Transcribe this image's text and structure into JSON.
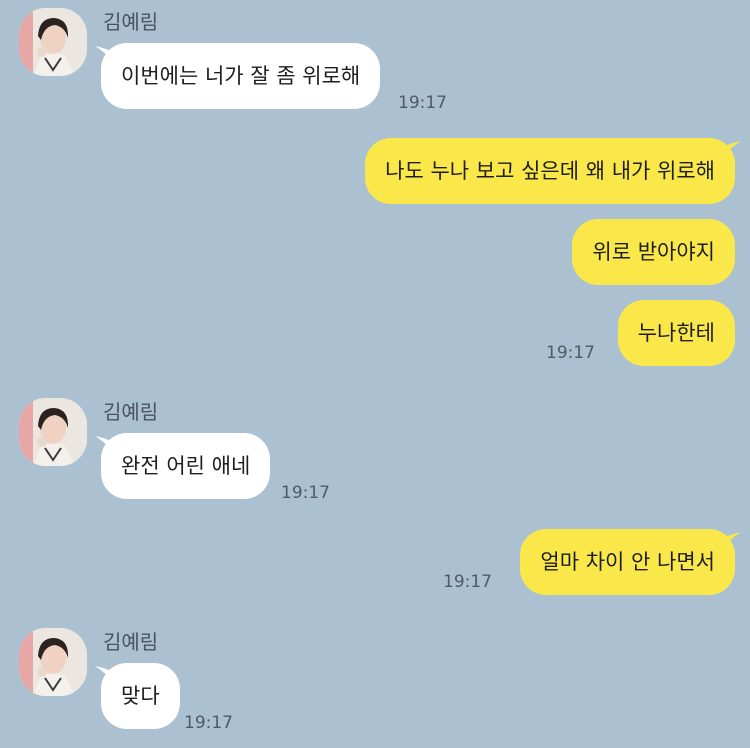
{
  "colors": {
    "background": "#abc1d1",
    "incoming_bubble": "#ffffff",
    "outgoing_bubble": "#fae84a",
    "sender_name": "#4a5260",
    "timestamp": "#4f5a66"
  },
  "messages": {
    "g1": {
      "sender": "김예림",
      "avatar_icon": "profile-photo",
      "text": "이번에는 너가 잘 좀 위로해",
      "time": "19:17"
    },
    "o1": {
      "line1": "나도 누나 보고 싶은데 왜 내가 위로해",
      "line2": "위로 받아야지",
      "line3": "누나한테",
      "time": "19:17"
    },
    "g2": {
      "sender": "김예림",
      "avatar_icon": "profile-photo",
      "text": "완전 어린 애네",
      "time": "19:17"
    },
    "o2": {
      "text": "얼마 차이 안 나면서",
      "time": "19:17"
    },
    "g3": {
      "sender": "김예림",
      "avatar_icon": "profile-photo",
      "text": "맞다",
      "time": "19:17"
    }
  }
}
